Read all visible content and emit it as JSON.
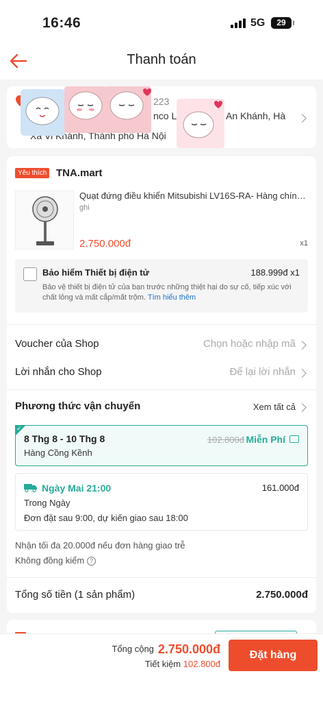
{
  "status_bar": {
    "time": "16:46",
    "network": "5G",
    "battery": "29"
  },
  "header": {
    "title": "Thanh toán"
  },
  "address": {
    "line1_fragments": [
      "223"
    ],
    "line2_fragments": [
      "nco Lê",
      "An Khánh, Hà"
    ],
    "line3": "Xã Vi Khánh, Thành phố Hà Nội"
  },
  "shop": {
    "badge": "Yêu thích",
    "name": "TNA.mart",
    "product": {
      "name": "Quạt đứng điều khiển Mitsubishi LV16S-RA- Hàng chính hãng",
      "variant": "ghi",
      "price": "2.750.000đ",
      "quantity": "x1"
    },
    "insurance": {
      "title": "Bảo hiểm Thiết bị điện tử",
      "price": "188.999đ x1",
      "description": "Bảo vệ thiết bị điện tử của bạn trước những thiệt hại do sự cố, tiếp xúc với chất lỏng và mất cắp/mất trộm.",
      "link": "Tìm hiểu thêm"
    },
    "voucher": {
      "label": "Voucher của Shop",
      "value": "Chọn hoặc nhập mã"
    },
    "message": {
      "label": "Lời nhắn cho Shop",
      "value": "Để lại lời nhắn"
    },
    "shipping": {
      "title": "Phương thức vận chuyển",
      "see_all": "Xem tất cả",
      "selected": {
        "date": "8 Thg 8 - 10 Thg 8",
        "type": "Hàng Cồng Kềnh",
        "old_price": "102.800đ",
        "price": "Miễn Phí"
      },
      "alternative": {
        "title": "Ngày Mai 21:00",
        "price": "161.000đ",
        "type": "Trong Ngày",
        "note": "Đơn đặt sau 9:00, dự kiến giao sau 18:00"
      },
      "late_note": "Nhận tối đa 20.000đ nếu đơn hàng giao trễ",
      "no_check": "Không đồng kiểm"
    },
    "total": {
      "label": "Tổng số tiền (1 sản phẩm)",
      "value": "2.750.000đ"
    }
  },
  "footer": {
    "total_label": "Tổng cộng",
    "total_value": "2.750.000đ",
    "save_label": "Tiết kiệm",
    "save_value": "102.800đ",
    "order_button": "Đặt hàng"
  },
  "colors": {
    "accent": "#ee4d2d",
    "shipping_green": "#26aa99",
    "link_blue": "#1e74c9"
  }
}
